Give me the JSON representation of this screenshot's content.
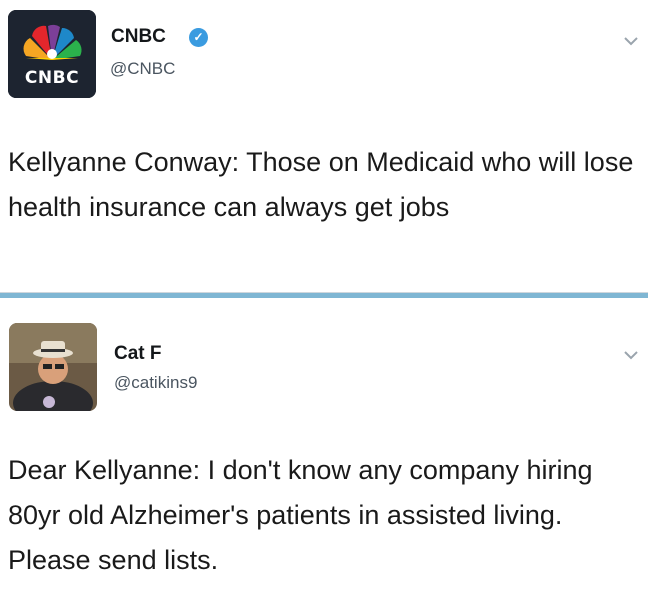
{
  "tweets": [
    {
      "display_name": "CNBC",
      "handle": "@CNBC",
      "verified": true,
      "avatar_text": "CNBC",
      "text": "Kellyanne Conway: Those on Medicaid who will lose health insurance can always get jobs"
    },
    {
      "display_name": "Cat F",
      "handle": "@catikins9",
      "verified": false,
      "text": "Dear Kellyanne: I don't know any company hiring 80yr old Alzheimer's patients in assisted living. Please send lists."
    }
  ],
  "icons": {
    "verified": "verified-badge-icon",
    "menu": "chevron-down-icon"
  },
  "colors": {
    "verified_blue": "#3a9be0",
    "separator": "#7fb6d3",
    "handle_gray": "#4a5560"
  }
}
